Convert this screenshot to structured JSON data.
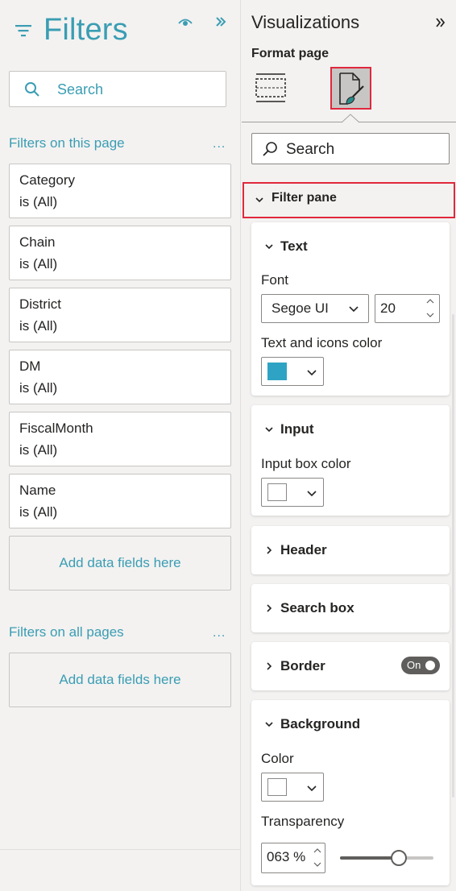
{
  "filters_pane": {
    "title": "Filters",
    "title_color": "#3a9db3",
    "icons": {
      "title": "filter-icon",
      "visibility": "eye-icon",
      "collapse": "double-chevron-right-icon"
    },
    "search": {
      "placeholder": "Search"
    },
    "this_page": {
      "label": "Filters on this page",
      "more": "...",
      "cards": [
        {
          "name": "Category",
          "value": "is (All)"
        },
        {
          "name": "Chain",
          "value": "is (All)"
        },
        {
          "name": "District",
          "value": "is (All)"
        },
        {
          "name": "DM",
          "value": "is (All)"
        },
        {
          "name": "FiscalMonth",
          "value": "is (All)"
        },
        {
          "name": "Name",
          "value": "is (All)"
        }
      ],
      "add_fields": "Add data fields here"
    },
    "all_pages": {
      "label": "Filters on all pages",
      "more": "...",
      "add_fields": "Add data fields here"
    }
  },
  "viz_pane": {
    "title": "Visualizations",
    "subtitle": "Format page",
    "tabs": [
      {
        "name": "fields-icon",
        "active": false
      },
      {
        "name": "format-paintbrush-icon",
        "active": true
      }
    ],
    "search": {
      "placeholder": "Search"
    },
    "section": {
      "label": "Filter pane",
      "expanded": true
    },
    "cards": {
      "text": {
        "title": "Text",
        "expanded": true,
        "font_label": "Font",
        "font_family": "Segoe UI",
        "font_size": "20",
        "color_label": "Text and icons color",
        "color": "#2ea3c4"
      },
      "input": {
        "title": "Input",
        "expanded": true,
        "color_label": "Input box color",
        "color": "#ffffff"
      },
      "header": {
        "title": "Header",
        "expanded": false
      },
      "search_box": {
        "title": "Search box",
        "expanded": false
      },
      "border": {
        "title": "Border",
        "expanded": false,
        "toggle_label": "On",
        "toggle_on": true
      },
      "background": {
        "title": "Background",
        "expanded": true,
        "color_label": "Color",
        "color": "#ffffff",
        "transparency_label": "Transparency",
        "transparency_value": "063 %",
        "transparency_fraction": 0.63
      }
    }
  }
}
